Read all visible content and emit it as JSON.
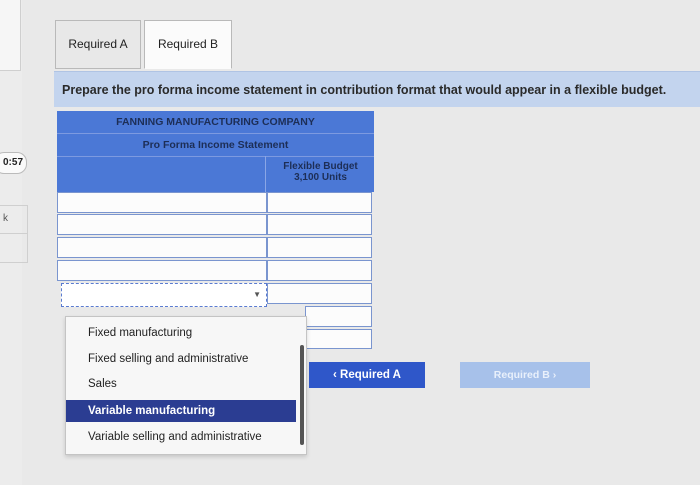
{
  "timer": "0:57",
  "left_label": "k",
  "tabs": [
    {
      "label": "Required A"
    },
    {
      "label": "Required B"
    }
  ],
  "instruction": "Prepare the pro forma income statement in contribution format that would appear in a flexible budget.",
  "statement": {
    "company": "FANNING MANUFACTURING COMPANY",
    "title": "Pro Forma Income Statement",
    "column_header_line1": "Flexible Budget",
    "column_header_line2": "3,100 Units"
  },
  "dropdown": {
    "selected_value": "",
    "options": [
      "Fixed manufacturing",
      "Fixed selling and administrative",
      "Sales",
      "Variable manufacturing",
      "Variable selling and administrative"
    ],
    "highlighted": "Variable manufacturing"
  },
  "nav": {
    "prev_label": "Required A",
    "next_label": "Required B"
  },
  "colors": {
    "header_blue": "#4b78d6",
    "instruction_bg": "#c3d4ee",
    "nav_active": "#2f57c9",
    "nav_disabled": "#a7c1ea",
    "highlight": "#2b3d92"
  }
}
